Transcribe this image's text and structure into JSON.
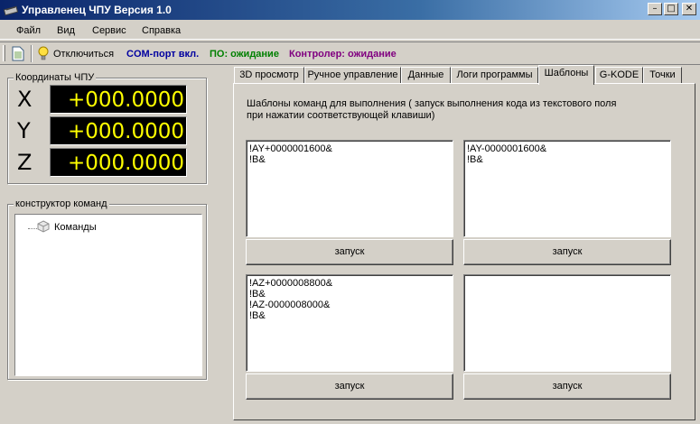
{
  "window": {
    "title": "Управленец ЧПУ Версия 1.0"
  },
  "menu": [
    "Файл",
    "Вид",
    "Сервис",
    "Справка"
  ],
  "toolbar": {
    "disconnect_label": "Отключиться",
    "com_status": "COM-порт вкл.",
    "po_status": "ПО: ожидание",
    "controller_status": "Контролер: ожидание",
    "colors": {
      "com": "#0000a0",
      "po": "#008000",
      "controller": "#800080"
    }
  },
  "coords": {
    "legend": "Координаты ЧПУ",
    "axes": [
      {
        "letter": "X",
        "value": "+000.0000"
      },
      {
        "letter": "Y",
        "value": "+000.0000"
      },
      {
        "letter": "Z",
        "value": "+000.0000"
      }
    ]
  },
  "constructor": {
    "legend": "конструктор команд",
    "root_label": "Команды"
  },
  "tabs": [
    "3D просмотр",
    "Ручное управление",
    "Данные",
    "Логи программы",
    "Шаблоны",
    "G-KODE",
    "Точки"
  ],
  "active_tab": "Шаблоны",
  "templates": {
    "description": "Шаблоны команд для выполнения ( запуск выполнения кода из текстового поля при нажатии соответствующей клавиши)",
    "boxes": [
      {
        "text": "!AY+0000001600&\n!B&",
        "button": "запуск"
      },
      {
        "text": "!AY-0000001600&\n!B&",
        "button": "запуск"
      },
      {
        "text": "!AZ+0000008800&\n!B&\n!AZ-0000008000&\n!B&",
        "button": "запуск"
      },
      {
        "text": "",
        "button": "запуск"
      }
    ]
  }
}
